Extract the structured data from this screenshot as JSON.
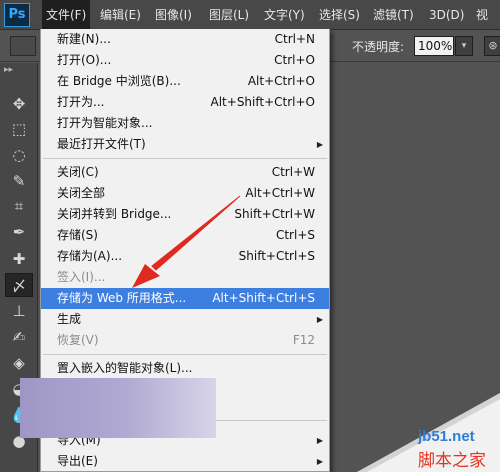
{
  "app": {
    "logo": "Ps"
  },
  "menubar": {
    "items": [
      {
        "label": "文件(F)"
      },
      {
        "label": "编辑(E)"
      },
      {
        "label": "图像(I)"
      },
      {
        "label": "图层(L)"
      },
      {
        "label": "文字(Y)"
      },
      {
        "label": "选择(S)"
      },
      {
        "label": "滤镜(T)"
      },
      {
        "label": "3D(D)"
      },
      {
        "label": "视"
      }
    ]
  },
  "options": {
    "opacity_label": "不透明度:",
    "opacity_value": "100%",
    "dropdown_glyph": "▾",
    "airbrush_glyph": "⊛"
  },
  "toolbar": {
    "collapse_glyph": "▸▸",
    "tools": [
      {
        "icon": "move-icon",
        "glyph": "✥"
      },
      {
        "icon": "marquee-icon",
        "glyph": "⬚"
      },
      {
        "icon": "lasso-icon",
        "glyph": "◌"
      },
      {
        "icon": "quick-select-icon",
        "glyph": "✎"
      },
      {
        "icon": "crop-icon",
        "glyph": "⌗"
      },
      {
        "icon": "eyedropper-icon",
        "glyph": "✒"
      },
      {
        "icon": "spot-heal-icon",
        "glyph": "✚"
      },
      {
        "icon": "brush-icon",
        "glyph": "〆"
      },
      {
        "icon": "stamp-icon",
        "glyph": "⊥"
      },
      {
        "icon": "history-brush-icon",
        "glyph": "✍"
      },
      {
        "icon": "eraser-icon",
        "glyph": "◈"
      },
      {
        "icon": "paint-bucket-icon",
        "glyph": "◒"
      },
      {
        "icon": "blur-icon",
        "glyph": "💧"
      },
      {
        "icon": "dodge-icon",
        "glyph": "●"
      }
    ]
  },
  "file_menu": {
    "items": [
      {
        "label": "新建(N)...",
        "shortcut": "Ctrl+N"
      },
      {
        "label": "打开(O)...",
        "shortcut": "Ctrl+O"
      },
      {
        "label": "在 Bridge 中浏览(B)...",
        "shortcut": "Alt+Ctrl+O"
      },
      {
        "label": "打开为...",
        "shortcut": "Alt+Shift+Ctrl+O"
      },
      {
        "label": "打开为智能对象...",
        "shortcut": ""
      },
      {
        "label": "最近打开文件(T)",
        "shortcut": "",
        "submenu": true
      },
      {
        "label": "关闭(C)",
        "shortcut": "Ctrl+W"
      },
      {
        "label": "关闭全部",
        "shortcut": "Alt+Ctrl+W"
      },
      {
        "label": "关闭并转到 Bridge...",
        "shortcut": "Shift+Ctrl+W"
      },
      {
        "label": "存储(S)",
        "shortcut": "Ctrl+S"
      },
      {
        "label": "存储为(A)...",
        "shortcut": "Shift+Ctrl+S"
      },
      {
        "label": "签入(I)...",
        "shortcut": "",
        "disabled": true
      },
      {
        "label": "存储为 Web 所用格式...",
        "shortcut": "Alt+Shift+Ctrl+S",
        "highlighted": true
      },
      {
        "label": "生成",
        "shortcut": "",
        "submenu": true
      },
      {
        "label": "恢复(V)",
        "shortcut": "F12",
        "disabled": true
      },
      {
        "label": "置入嵌入的智能对象(L)...",
        "shortcut": ""
      },
      {
        "label": "导入(M)",
        "shortcut": "",
        "submenu": true
      },
      {
        "label": "导出(E)",
        "shortcut": "",
        "submenu": true
      }
    ],
    "submenu_glyph": "▶"
  },
  "watermark": {
    "domain": "jb51.net",
    "text": "脚本之家"
  }
}
